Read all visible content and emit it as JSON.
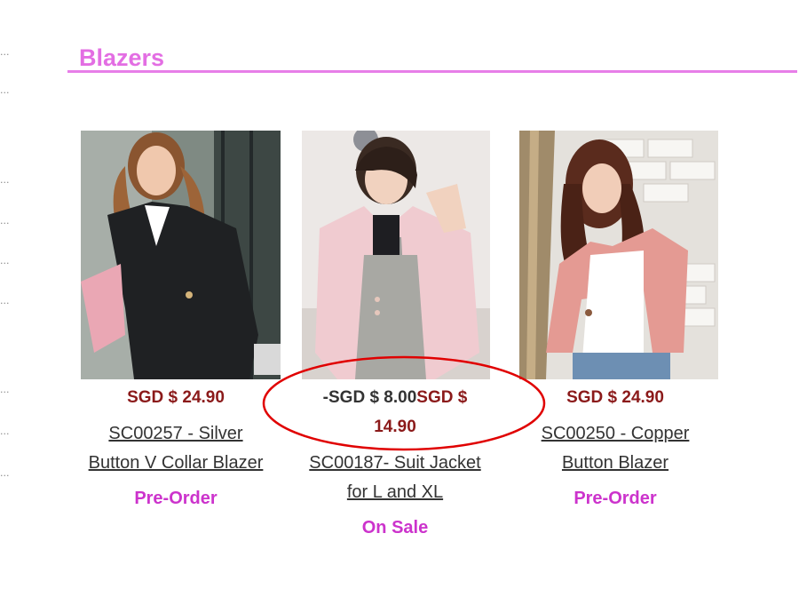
{
  "category": {
    "title": "Blazers"
  },
  "sidebar_dots": "...",
  "products": [
    {
      "price": "SGD $ 24.90",
      "name_line1": "SC00257 - Silver",
      "name_line2": "Button V Collar Blazer",
      "status": "Pre-Order",
      "image": "photo of woman in black blazer"
    },
    {
      "sale_prefix": "-SGD $ 8.00",
      "price_line1": "SGD $",
      "price_line2": "14.90",
      "name_line1": "SC00187- Suit Jacket",
      "name_line2": "for L and XL",
      "status": "On Sale",
      "image": "photo of woman in light pink jacket"
    },
    {
      "price": "SGD $ 24.90",
      "name_line1": "SC00250 - Copper",
      "name_line2": "Button Blazer",
      "status": "Pre-Order",
      "image": "photo of woman in pink blazer"
    }
  ],
  "colors": {
    "title": "#e36ee3",
    "rule": "#e77ee8",
    "price": "#8b1a1a",
    "status": "#cc33cc",
    "annotation": "#e00000"
  }
}
